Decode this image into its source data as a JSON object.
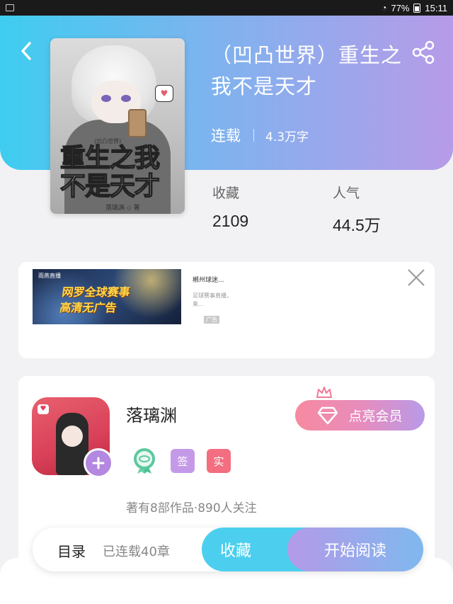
{
  "status_bar": {
    "battery": "77%",
    "time": "15:11"
  },
  "book": {
    "title": "（凹凸世界）重生之我不是天才",
    "status": "连载",
    "word_count": "4.3万字",
    "cover_title": "重生之我不是天才",
    "cover_small_text": "(凹凸世界)",
    "cover_author": "落璃渊 ◇ 著"
  },
  "stats": {
    "collect_label": "收藏",
    "collect_value": "2109",
    "popularity_label": "人气",
    "popularity_value": "44.5万"
  },
  "ad": {
    "image_logo": "雨燕直播",
    "image_headline_1": "网罗全球赛事",
    "image_headline_2": "高清无广告",
    "name": "郴州球迷...",
    "desc": "足球赛事直播，来...",
    "tag": "广告"
  },
  "author": {
    "name": "落璃渊",
    "vip_label": "点亮会员",
    "badge_sign": "签",
    "badge_real": "实",
    "stats": "著有8部作品·890人关注"
  },
  "action_bar": {
    "toc_label": "目录",
    "toc_count": "已连载40章",
    "collect_label": "收藏",
    "read_label": "开始阅读"
  },
  "colors": {
    "header_start": "#3ecdf0",
    "header_end": "#b79be8",
    "vip_start": "#f68aa0",
    "collect_btn": "#4ccfee"
  }
}
